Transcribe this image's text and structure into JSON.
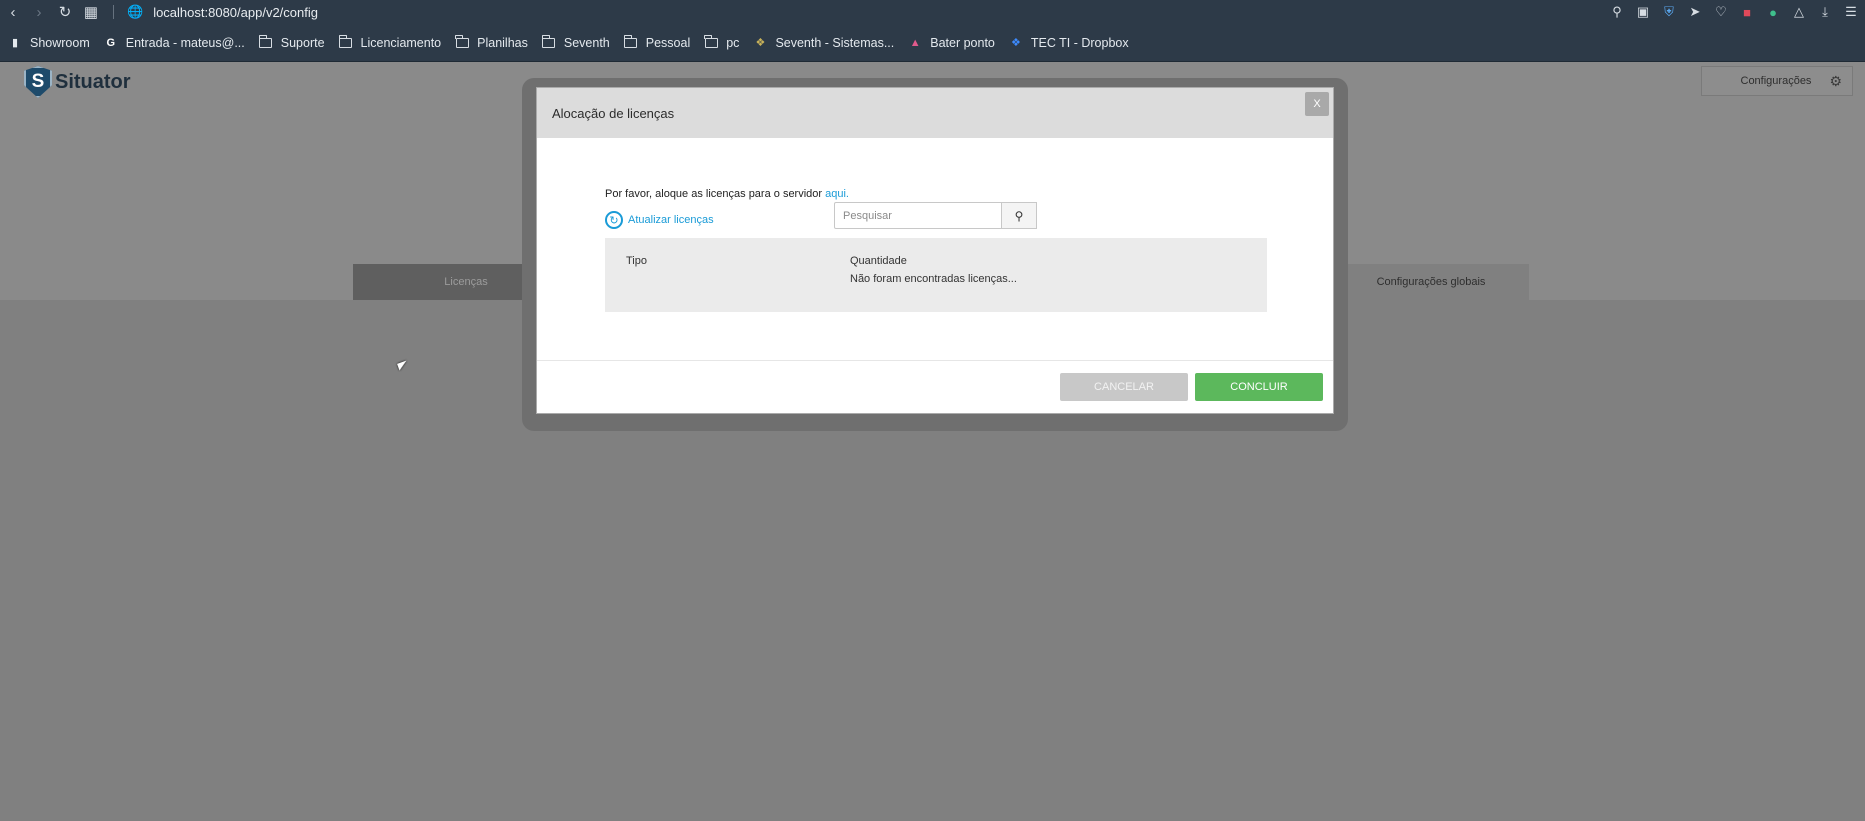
{
  "browser": {
    "url": "localhost:8080/app/v2/config",
    "nav_icons": [
      "back-icon",
      "forward-icon",
      "reload-icon",
      "apps-icon"
    ],
    "extension_icons": [
      "find-icon",
      "camera-icon",
      "shield-icon",
      "send-icon",
      "heart-icon",
      "gift-icon",
      "extension-icon",
      "cube-icon",
      "download-icon",
      "menu-icon"
    ],
    "bookmarks": [
      {
        "label": "Showroom",
        "icon": "page-icon"
      },
      {
        "label": "Entrada - mateus@...",
        "icon": "google-icon"
      },
      {
        "label": "Suporte",
        "icon": "folder-icon"
      },
      {
        "label": "Licenciamento",
        "icon": "folder-icon"
      },
      {
        "label": "Planilhas",
        "icon": "folder-icon"
      },
      {
        "label": "Seventh",
        "icon": "folder-icon"
      },
      {
        "label": "Pessoal",
        "icon": "folder-icon"
      },
      {
        "label": "pc",
        "icon": "folder-icon"
      },
      {
        "label": "Seventh - Sistemas...",
        "icon": "seventh-icon"
      },
      {
        "label": "Bater ponto",
        "icon": "clock-app-icon"
      },
      {
        "label": "TEC TI - Dropbox",
        "icon": "dropbox-icon"
      }
    ]
  },
  "app": {
    "logo_letter": "S",
    "logo_text": "Situator",
    "config_button": "Configurações",
    "tabs": {
      "licenses": "Licenças",
      "global": "Configurações globais"
    }
  },
  "modal": {
    "title": "Alocação de licenças",
    "close_label": "X",
    "allocate_text": "Por favor, aloque as licenças para o servidor",
    "allocate_link": "aqui.",
    "refresh_label": "Atualizar licenças",
    "search_placeholder": "Pesquisar",
    "table": {
      "col_type": "Tipo",
      "col_quantity": "Quantidade",
      "empty_message": "Não foram encontradas licenças..."
    },
    "cancel_label": "CANCELAR",
    "confirm_label": "CONCLUIR"
  },
  "colors": {
    "browser_chrome": "#2d3a48",
    "overlay": "#808080",
    "link": "#1a9bd7",
    "confirm": "#5cb85c"
  }
}
